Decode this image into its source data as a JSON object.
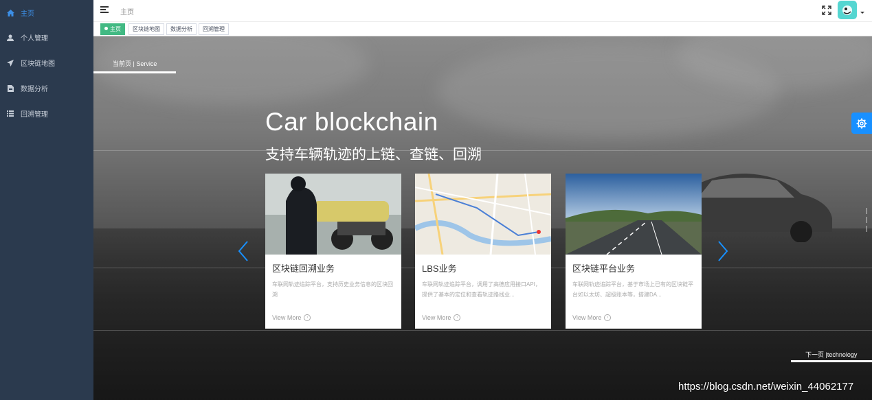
{
  "sidebar": {
    "items": [
      {
        "label": "主页",
        "icon": "home-icon",
        "active": true
      },
      {
        "label": "个人管理",
        "icon": "user-icon",
        "active": false
      },
      {
        "label": "区块链地图",
        "icon": "send-icon",
        "active": false
      },
      {
        "label": "数据分析",
        "icon": "document-icon",
        "active": false
      },
      {
        "label": "回溯管理",
        "icon": "list-icon",
        "active": false
      }
    ]
  },
  "header": {
    "breadcrumb": "主页",
    "avatar_color": "#55d6d1"
  },
  "tags": [
    {
      "label": "主页",
      "active": true
    },
    {
      "label": "区块链地图",
      "active": false
    },
    {
      "label": "数据分析",
      "active": false
    },
    {
      "label": "回溯管理",
      "active": false
    }
  ],
  "hero": {
    "current_page": "当前页 | Service",
    "title": "Car blockchain",
    "subtitle": "支持车辆轨迹的上链、查链、回溯",
    "next_page": "下一页 |technology",
    "watermark": "https://blog.csdn.net/weixin_44062177"
  },
  "cards": [
    {
      "title": "区块链回溯业务",
      "desc": "车联网轨迹追踪平台，支持历史业务信息的区块回溯",
      "more": "View More",
      "image": "police-motorcycle"
    },
    {
      "title": "LBS业务",
      "desc": "车联网轨迹追踪平台，调用了高德应用接口API，提供了基本的定位和查看轨迹路线业...",
      "more": "View More",
      "image": "street-map"
    },
    {
      "title": "区块链平台业务",
      "desc": "车联网轨迹追踪平台，基于市场上已有的区块链平台如以太坊、超级账本等，搭建DA...",
      "more": "View More",
      "image": "highway-road"
    }
  ],
  "colors": {
    "sidebar_bg": "#2b3a4e",
    "active": "#3c8fe6",
    "tag_active": "#42b983",
    "settings": "#1890ff"
  }
}
